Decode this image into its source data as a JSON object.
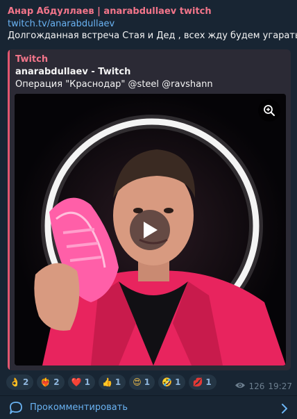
{
  "message": {
    "sender": "Анар Абдуллаев | anarabdullaev twitch",
    "link": "twitch.tv/anarabdullaev",
    "text": "Долгожданная встреча Стая и Дед , всех жду будем угарать"
  },
  "preview": {
    "site": "Twitch",
    "title": "anarabdullaev - Twitch",
    "description": "Операция \"Краснодар\" @steel @ravshann",
    "zoom_icon": "zoom-in-icon",
    "play_icon": "play-icon"
  },
  "reactions": [
    {
      "emoji": "👌",
      "count": "2"
    },
    {
      "emoji": "❤️‍🔥",
      "count": "2"
    },
    {
      "emoji": "❤️",
      "count": "1"
    },
    {
      "emoji": "👍",
      "count": "1"
    },
    {
      "emoji": "😍",
      "count": "1"
    },
    {
      "emoji": "🤣",
      "count": "1"
    },
    {
      "emoji": "💋",
      "count": "1"
    }
  ],
  "meta": {
    "views": "126",
    "time": "19:27",
    "views_icon": "eye-icon"
  },
  "comments": {
    "label": "Прокомментировать",
    "icon": "comment-icon"
  },
  "colors": {
    "background": "#182533",
    "accent_pink": "#f2758a",
    "link_blue": "#6ab3f3"
  }
}
